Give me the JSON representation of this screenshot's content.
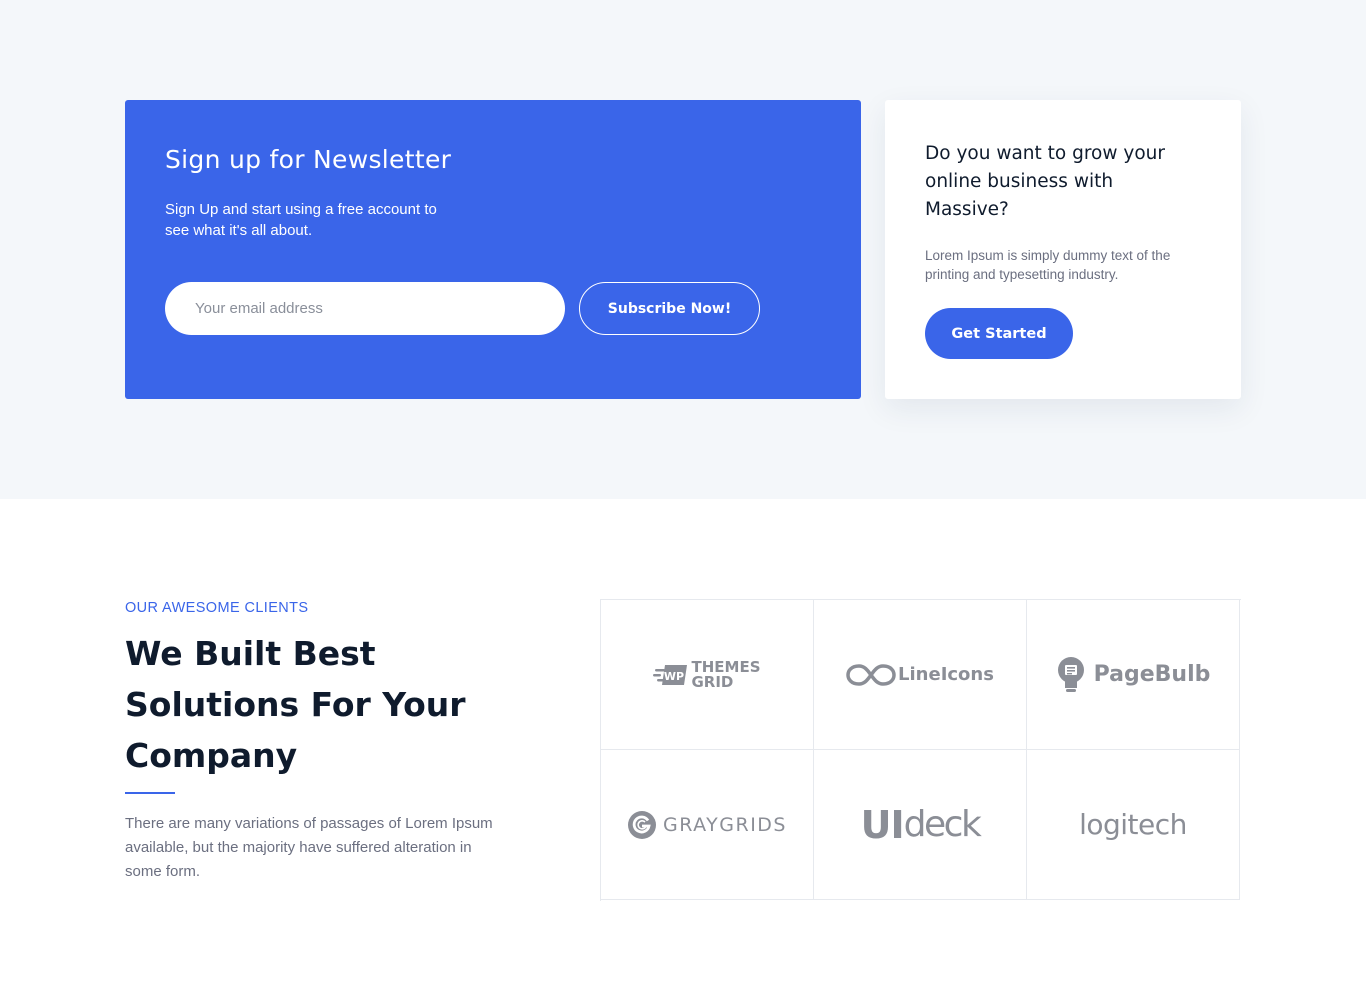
{
  "newsletter": {
    "title": "Sign up for Newsletter",
    "description": "Sign Up and start using a free account to see what it's all about.",
    "email_placeholder": "Your email address",
    "subscribe_label": "Subscribe Now!"
  },
  "cta": {
    "title": "Do you want to grow your online business with Massive?",
    "description": "Lorem Ipsum is simply dummy text of the printing and typesetting industry.",
    "button_label": "Get Started"
  },
  "clients": {
    "eyebrow": "OUR AWESOME CLIENTS",
    "title": "We Built Best Solutions For Your Company",
    "description": "There are many variations of passages of Lorem Ipsum available, but the majority have suffered alteration in some form.",
    "logos": [
      {
        "name": "WP THEMES GRID",
        "badge": "WP",
        "line1": "THEMES",
        "line2": "GRID"
      },
      {
        "name": "LineIcons",
        "text": "LineIcons"
      },
      {
        "name": "PageBulb",
        "text": "PageBulb"
      },
      {
        "name": "GRAYGRIDS",
        "text": "GRAYGRIDS"
      },
      {
        "name": "UIdeck",
        "text_a": "UI",
        "text_b": "deck"
      },
      {
        "name": "logitech",
        "text": "logitech"
      }
    ]
  },
  "colors": {
    "brand_blue": "#3a65e9",
    "section_bg": "#f4f7fa",
    "logo_gray": "#8b8e96"
  }
}
